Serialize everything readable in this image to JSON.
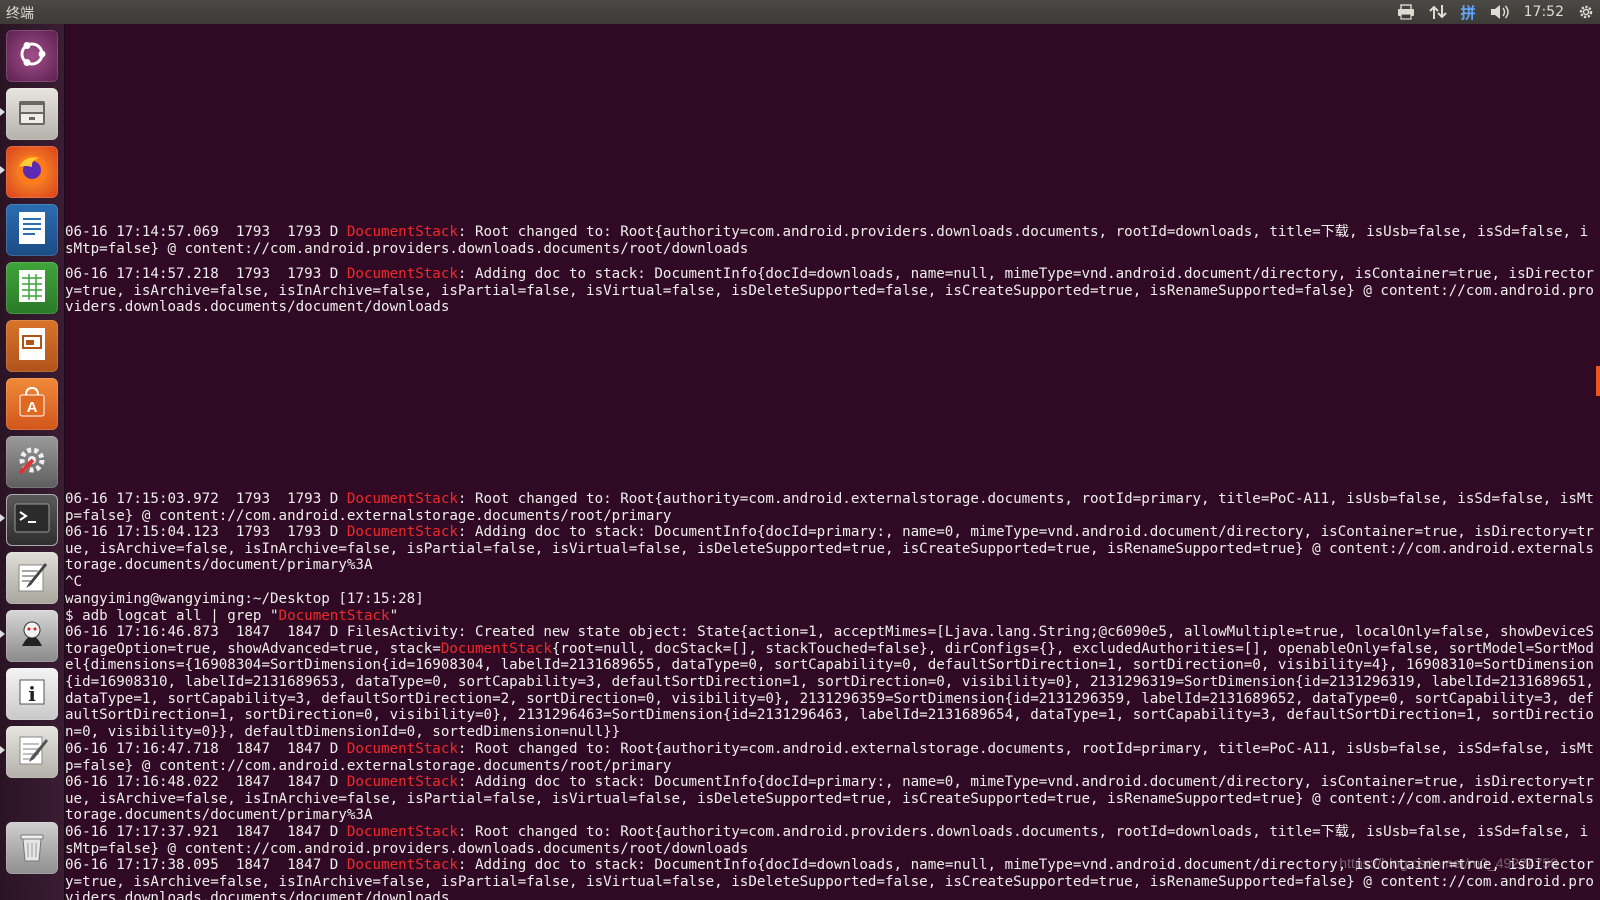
{
  "topbar": {
    "title": "终端",
    "ime": "拼",
    "time": "17:52",
    "icons": [
      "printer-icon",
      "network-icon",
      "ime-icon",
      "volume-icon",
      "settings-gear-icon"
    ]
  },
  "launcher": {
    "items": [
      {
        "name": "ubuntu-dash",
        "icon": "ubuntu-logo-icon"
      },
      {
        "name": "files",
        "icon": "file-cabinet-icon"
      },
      {
        "name": "firefox",
        "icon": "firefox-icon"
      },
      {
        "name": "writer",
        "icon": "document-icon"
      },
      {
        "name": "calc",
        "icon": "spreadsheet-icon"
      },
      {
        "name": "impress",
        "icon": "presentation-icon"
      },
      {
        "name": "software-center",
        "icon": "shopping-bag-icon"
      },
      {
        "name": "system-settings",
        "icon": "wrench-gear-icon"
      },
      {
        "name": "terminal",
        "icon": "terminal-icon"
      },
      {
        "name": "text-editor",
        "icon": "pencil-paper-icon"
      },
      {
        "name": "android-tool",
        "icon": "android-icon"
      },
      {
        "name": "system-info",
        "icon": "info-icon"
      },
      {
        "name": "notes",
        "icon": "notepad-icon"
      },
      {
        "name": "trash",
        "icon": "trash-icon"
      }
    ]
  },
  "terminal": {
    "highlight": "DocumentStack",
    "lines": [
      "06-16 17:14:57.069  1793  1793 D DocumentStack: Root changed to: Root{authority=com.android.providers.downloads.documents, rootId=downloads, title=下载, isUsb=false, isSd=false, isMtp=false} @ content://com.android.providers.downloads.documents/root/downloads",
      "06-16 17:14:57.218  1793  1793 D DocumentStack: Adding doc to stack: DocumentInfo{docId=downloads, name=null, mimeType=vnd.android.document/directory, isContainer=true, isDirectory=true, isArchive=false, isInArchive=false, isPartial=false, isVirtual=false, isDeleteSupported=false, isCreateSupported=true, isRenameSupported=false} @ content://com.android.providers.downloads.documents/document/downloads",
      "06-16 17:15:03.972  1793  1793 D DocumentStack: Root changed to: Root{authority=com.android.externalstorage.documents, rootId=primary, title=PoC-A11, isUsb=false, isSd=false, isMtp=false} @ content://com.android.externalstorage.documents/root/primary",
      "06-16 17:15:04.123  1793  1793 D DocumentStack: Adding doc to stack: DocumentInfo{docId=primary:, name=0, mimeType=vnd.android.document/directory, isContainer=true, isDirectory=true, isArchive=false, isInArchive=false, isPartial=false, isVirtual=false, isDeleteSupported=true, isCreateSupported=true, isRenameSupported=true} @ content://com.android.externalstorage.documents/document/primary%3A",
      "^C",
      "wangyiming@wangyiming:~/Desktop [17:15:28]",
      "$ adb logcat all | grep \"DocumentStack\"",
      "06-16 17:16:46.873  1847  1847 D FilesActivity: Created new state object: State{action=1, acceptMimes=[Ljava.lang.String;@c6090e5, allowMultiple=true, localOnly=false, showDeviceStorageOption=true, showAdvanced=true, stack=DocumentStack{root=null, docStack=[], stackTouched=false}, dirConfigs={}, excludedAuthorities=[], openableOnly=false, sortModel=SortModel{dimensions={16908304=SortDimension{id=16908304, labelId=2131689655, dataType=0, sortCapability=0, defaultSortDirection=1, sortDirection=0, visibility=4}, 16908310=SortDimension{id=16908310, labelId=2131689653, dataType=0, sortCapability=3, defaultSortDirection=1, sortDirection=0, visibility=0}, 2131296319=SortDimension{id=2131296319, labelId=2131689651, dataType=1, sortCapability=3, defaultSortDirection=2, sortDirection=0, visibility=0}, 2131296359=SortDimension{id=2131296359, labelId=2131689652, dataType=0, sortCapability=3, defaultSortDirection=1, sortDirection=0, visibility=0}, 2131296463=SortDimension{id=2131296463, labelId=2131689654, dataType=1, sortCapability=3, defaultSortDirection=1, sortDirection=0, visibility=0}}, defaultDimensionId=0, sortedDimension=null}}",
      "06-16 17:16:47.718  1847  1847 D DocumentStack: Root changed to: Root{authority=com.android.externalstorage.documents, rootId=primary, title=PoC-A11, isUsb=false, isSd=false, isMtp=false} @ content://com.android.externalstorage.documents/root/primary",
      "06-16 17:16:48.022  1847  1847 D DocumentStack: Adding doc to stack: DocumentInfo{docId=primary:, name=0, mimeType=vnd.android.document/directory, isContainer=true, isDirectory=true, isArchive=false, isInArchive=false, isPartial=false, isVirtual=false, isDeleteSupported=true, isCreateSupported=true, isRenameSupported=true} @ content://com.android.externalstorage.documents/document/primary%3A",
      "06-16 17:17:37.921  1847  1847 D DocumentStack: Root changed to: Root{authority=com.android.providers.downloads.documents, rootId=downloads, title=下载, isUsb=false, isSd=false, isMtp=false} @ content://com.android.providers.downloads.documents/root/downloads",
      "06-16 17:17:38.095  1847  1847 D DocumentStack: Adding doc to stack: DocumentInfo{docId=downloads, name=null, mimeType=vnd.android.document/directory, isContainer=true, isDirectory=true, isArchive=false, isInArchive=false, isPartial=false, isVirtual=false, isDeleteSupported=false, isCreateSupported=true, isRenameSupported=false} @ content://com.android.providers.downloads.documents/document/downloads"
    ]
  },
  "watermark": "https://blog.csdn.net/m0_49224758",
  "colors": {
    "terminal_bg": "#300a24",
    "text": "#eeeeec",
    "highlight": "#ef2929",
    "accent": "#e95420"
  }
}
